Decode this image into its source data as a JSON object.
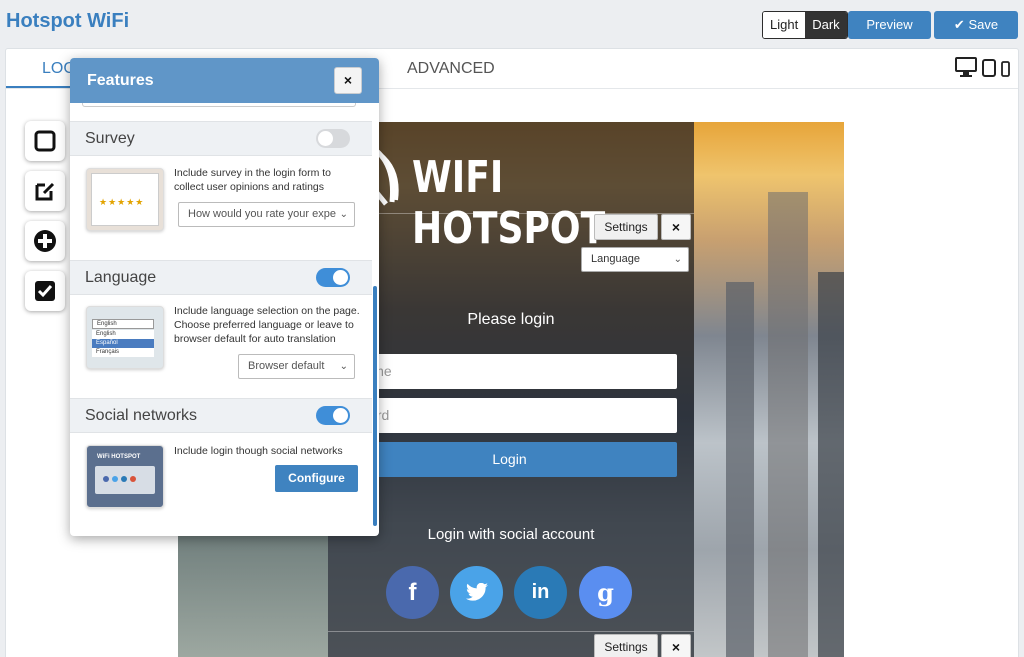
{
  "app": {
    "title": "Hotspot WiFi"
  },
  "header": {
    "theme_light": "Light",
    "theme_dark": "Dark",
    "preview_label": "Preview",
    "save_label": "Save"
  },
  "tabs": [
    {
      "label": "LOG",
      "active": true
    },
    {
      "label": "ADVANCED",
      "active": false
    }
  ],
  "device_icons": [
    "desktop-icon",
    "tablet-icon",
    "phone-icon"
  ],
  "tools": [
    "square-icon",
    "edit-icon",
    "plus-circle-icon",
    "checkbox-icon"
  ],
  "preview": {
    "logo_text": "WIFI HOTSPOT",
    "settings_label": "Settings",
    "close_label": "×",
    "language_select": "Language",
    "please_login": "Please login",
    "username_placeholder": "rname",
    "password_placeholder": "sword",
    "login_button": "Login",
    "social_title": "Login with social account",
    "social": [
      {
        "name": "facebook",
        "glyph": "f",
        "color": "#4a69ad"
      },
      {
        "name": "twitter",
        "glyph": "🐦",
        "color": "#4aa3e8"
      },
      {
        "name": "linkedin",
        "glyph": "in",
        "color": "#2a7ab6"
      },
      {
        "name": "google",
        "glyph": "g",
        "color": "#5a8ef0"
      }
    ]
  },
  "features": {
    "title": "Features",
    "close_label": "×",
    "sections": {
      "survey": {
        "title": "Survey",
        "enabled": false,
        "description": "Include survey in the login form to collect user opinions and ratings",
        "select_value": "How would you rate your expe"
      },
      "language": {
        "title": "Language",
        "enabled": true,
        "description": "Include language selection on the page. Choose preferred language or leave to browser default for auto translation",
        "select_value": "Browser default",
        "thumb_options": [
          "English",
          "English",
          "Español",
          "Français"
        ]
      },
      "social": {
        "title": "Social networks",
        "enabled": true,
        "description": "Include login though social networks",
        "configure_label": "Configure",
        "thumb_title": "WiFi HOTSPOT"
      }
    }
  },
  "colors": {
    "accent": "#3f83c0",
    "header_blue": "#6096c8"
  }
}
